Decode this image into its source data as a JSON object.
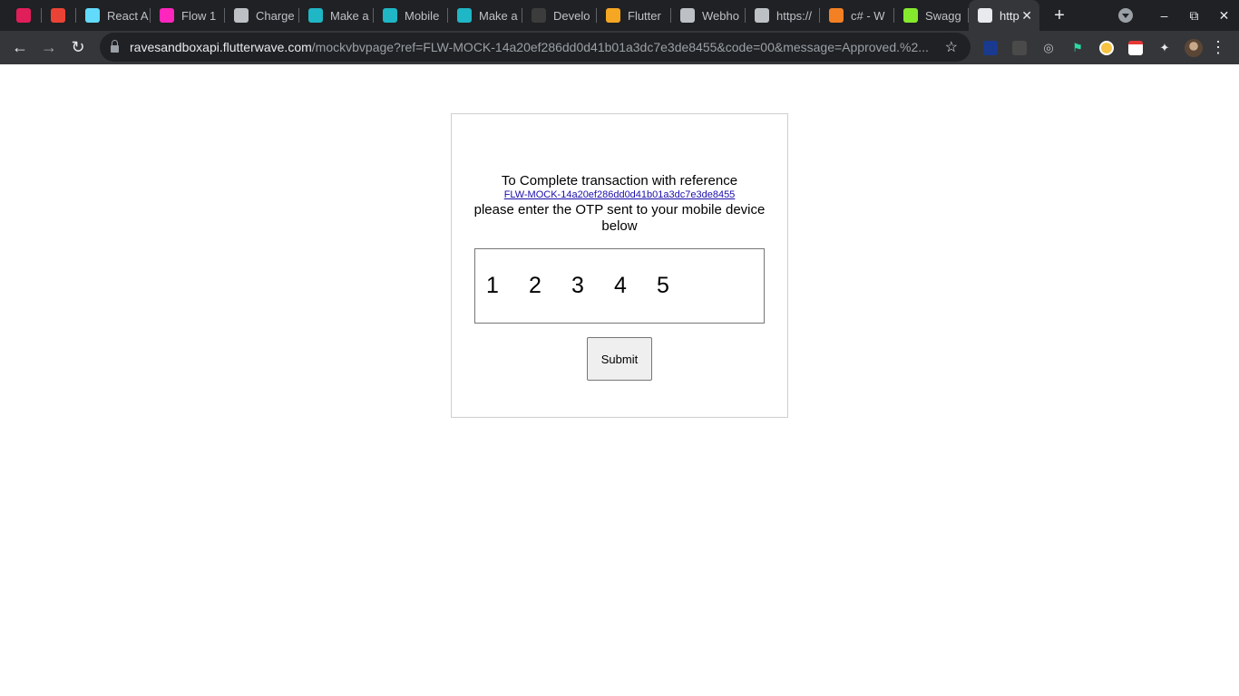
{
  "browser": {
    "tabs": [
      {
        "label": "",
        "icon": "slack-icon",
        "color": "#e01e5a"
      },
      {
        "label": "",
        "icon": "gmail-icon",
        "color": "#ea4335"
      },
      {
        "label": "React A",
        "icon": "react-icon",
        "color": "#61dafb"
      },
      {
        "label": "Flow 1",
        "icon": "adobe-xd-icon",
        "color": "#ff26be"
      },
      {
        "label": "Charge",
        "icon": "stack-icon",
        "color": "#bdc1c6"
      },
      {
        "label": "Make a",
        "icon": "rave-icon",
        "color": "#1fb6c6"
      },
      {
        "label": "Mobile",
        "icon": "rave-icon",
        "color": "#1fb6c6"
      },
      {
        "label": "Make a",
        "icon": "rave-icon",
        "color": "#1fb6c6"
      },
      {
        "label": "Develo",
        "icon": "github-icon",
        "color": "#3c3c3c"
      },
      {
        "label": "Flutter",
        "icon": "flutterwave-icon",
        "color": "#f5a623"
      },
      {
        "label": "Webho",
        "icon": "webhook-icon",
        "color": "#bdc1c6"
      },
      {
        "label": "https://",
        "icon": "webhook-icon",
        "color": "#bdc1c6"
      },
      {
        "label": "c# - W",
        "icon": "stackoverflow-icon",
        "color": "#f48024"
      },
      {
        "label": "Swagg",
        "icon": "swagger-icon",
        "color": "#85ea2d"
      },
      {
        "label": "http",
        "icon": "globe-icon",
        "color": "#e8eaed"
      }
    ],
    "url_host": "ravesandboxapi.flutterwave.com",
    "url_path": "/mockvbvpage?ref=FLW-MOCK-14a20ef286dd0d41b01a3dc7e3de8455&code=00&message=Approved.%2..."
  },
  "page": {
    "line1": "To Complete transaction with reference",
    "reference": "FLW-MOCK-14a20ef286dd0d41b01a3dc7e3de8455",
    "line2": "please enter the OTP sent to your mobile device below",
    "otp_digits": [
      "1",
      "2",
      "3",
      "4",
      "5"
    ],
    "submit_label": "Submit"
  }
}
